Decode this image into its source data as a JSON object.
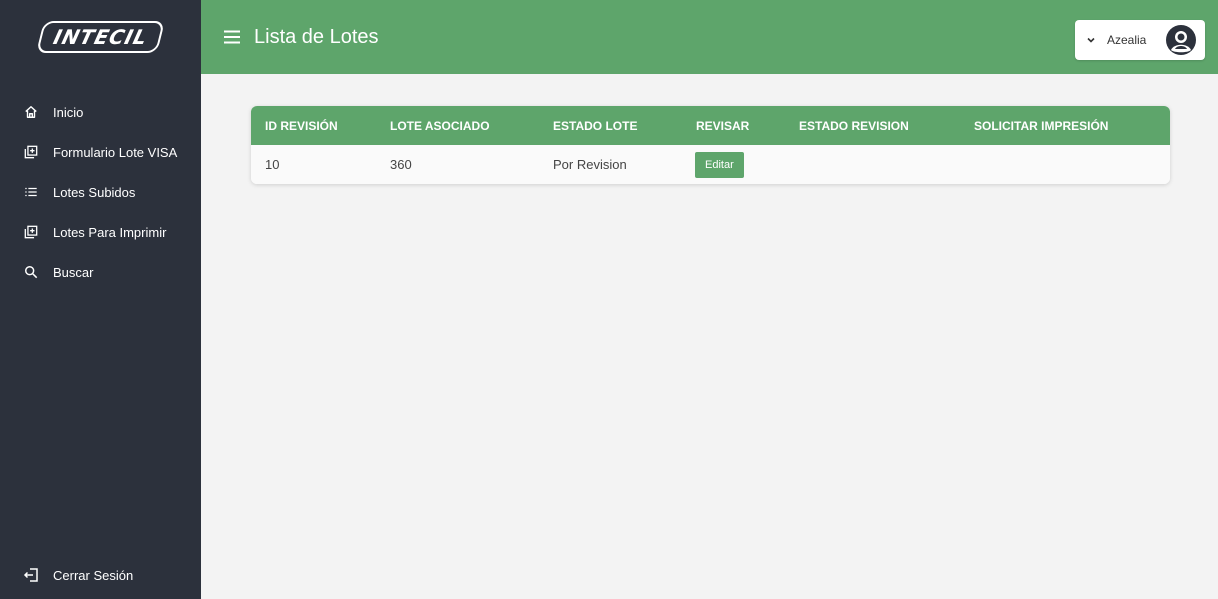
{
  "brand": {
    "logo_text": "INTECIL"
  },
  "sidebar": {
    "items": [
      {
        "label": "Inicio",
        "icon": "home-icon"
      },
      {
        "label": "Formulario Lote VISA",
        "icon": "add-box-icon"
      },
      {
        "label": "Lotes Subidos",
        "icon": "list-icon"
      },
      {
        "label": "Lotes Para Imprimir",
        "icon": "add-box-icon"
      },
      {
        "label": "Buscar",
        "icon": "search-icon"
      }
    ],
    "logout_label": "Cerrar Sesión"
  },
  "header": {
    "title": "Lista de Lotes",
    "user_name": "Azealia"
  },
  "table": {
    "columns": [
      "ID REVISIÓN",
      "LOTE ASOCIADO",
      "ESTADO LOTE",
      "REVISAR",
      "ESTADO REVISION",
      "SOLICITAR IMPRESIÓN"
    ],
    "rows": [
      {
        "id_revision": "10",
        "lote_asociado": "360",
        "estado_lote": "Por Revision",
        "revisar_label": "Editar",
        "estado_revision": "",
        "solicitar_impresion": ""
      }
    ]
  },
  "colors": {
    "accent": "#5ea56b",
    "sidebar_bg": "#2c313c",
    "page_bg": "#f3f3f3"
  }
}
